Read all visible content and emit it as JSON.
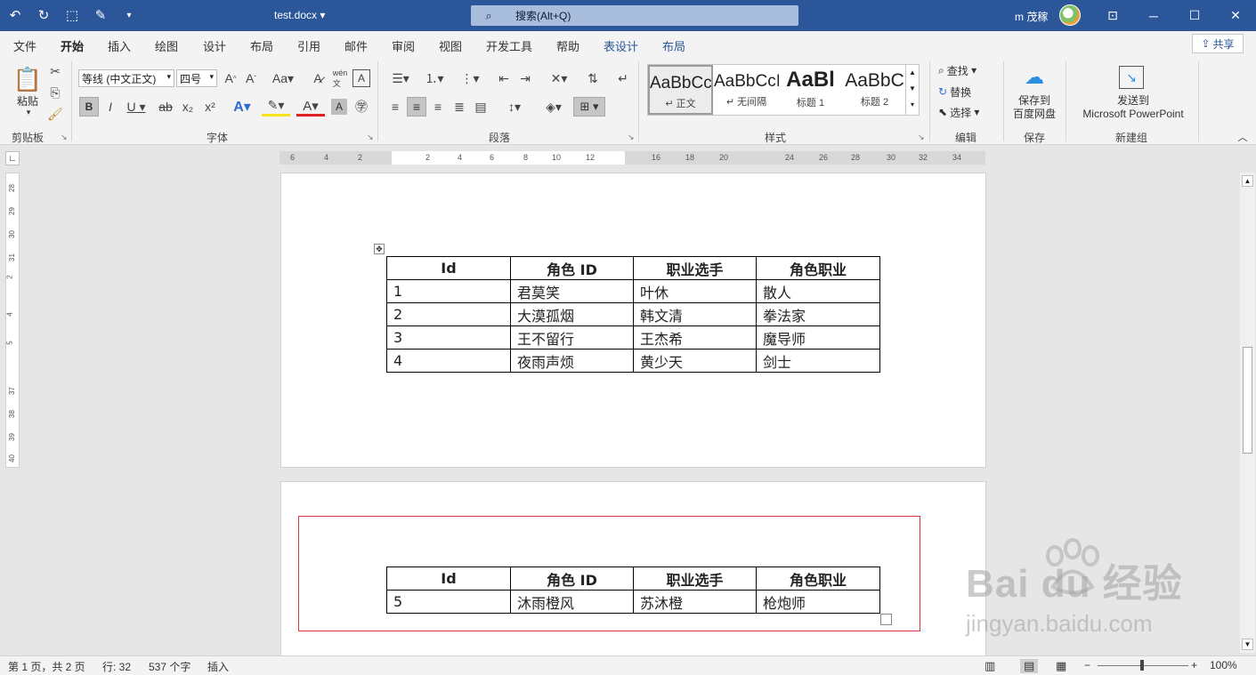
{
  "titlebar": {
    "doc_title": "test.docx",
    "search_placeholder": "搜索(Alt+Q)",
    "user": "m 茂稼"
  },
  "tabs": [
    "文件",
    "开始",
    "插入",
    "绘图",
    "设计",
    "布局",
    "引用",
    "邮件",
    "审阅",
    "视图",
    "开发工具",
    "帮助"
  ],
  "context_tabs": [
    "表设计",
    "布局"
  ],
  "active_tab": "开始",
  "share_label": "共享",
  "ribbon": {
    "clipboard": {
      "paste": "粘贴",
      "label": "剪贴板"
    },
    "font": {
      "name": "等线 (中文正文)",
      "size": "四号",
      "label": "字体"
    },
    "paragraph": {
      "label": "段落"
    },
    "styles": {
      "label": "样式",
      "items": [
        {
          "sample": "AaBbCcI",
          "name": "↵ 正文"
        },
        {
          "sample": "AaBbCcI",
          "name": "↵ 无间隔"
        },
        {
          "sample": "AaBl",
          "name": "标题 1"
        },
        {
          "sample": "AaBbC",
          "name": "标题 2"
        }
      ]
    },
    "editing": {
      "label": "编辑",
      "find": "查找",
      "replace": "替换",
      "select": "选择"
    },
    "save": {
      "label": "保存",
      "button": "保存到\n百度网盘",
      "line1": "保存到",
      "line2": "百度网盘"
    },
    "newgroup": {
      "label": "新建组",
      "line1": "发送到",
      "line2": "Microsoft PowerPoint"
    }
  },
  "hruler_ticks": [
    "6",
    "4",
    "2",
    "2",
    "4",
    "6",
    "8",
    "10",
    "12",
    "16",
    "18",
    "20",
    "24",
    "26",
    "28",
    "30",
    "32",
    "34"
  ],
  "vruler_ticks": [
    "28",
    "29",
    "30",
    "31",
    "2",
    "4",
    "5",
    "37",
    "38",
    "39",
    "40"
  ],
  "table1": {
    "headers": [
      "Id",
      "角色 ID",
      "职业选手",
      "角色职业"
    ],
    "rows": [
      [
        "1",
        "君莫笑",
        "叶休",
        "散人"
      ],
      [
        "2",
        "大漠孤烟",
        "韩文清",
        "拳法家"
      ],
      [
        "3",
        "王不留行",
        "王杰希",
        "魔导师"
      ],
      [
        "4",
        "夜雨声烦",
        "黄少天",
        "剑士"
      ]
    ]
  },
  "table2": {
    "headers": [
      "Id",
      "角色 ID",
      "职业选手",
      "角色职业"
    ],
    "rows": [
      [
        "5",
        "沐雨橙风",
        "苏沐橙",
        "枪炮师"
      ]
    ]
  },
  "status": {
    "page": "第 1 页，共 2 页",
    "line": "行: 32",
    "words": "537 个字",
    "mode": "插入",
    "zoom": "100%"
  },
  "watermark": {
    "big": "Bai du 经验",
    "small": "jingyan.baidu.com"
  },
  "colors": {
    "titlebar": "#2b579a",
    "accent": "#2b579a",
    "selection_box": "#d9373d"
  }
}
